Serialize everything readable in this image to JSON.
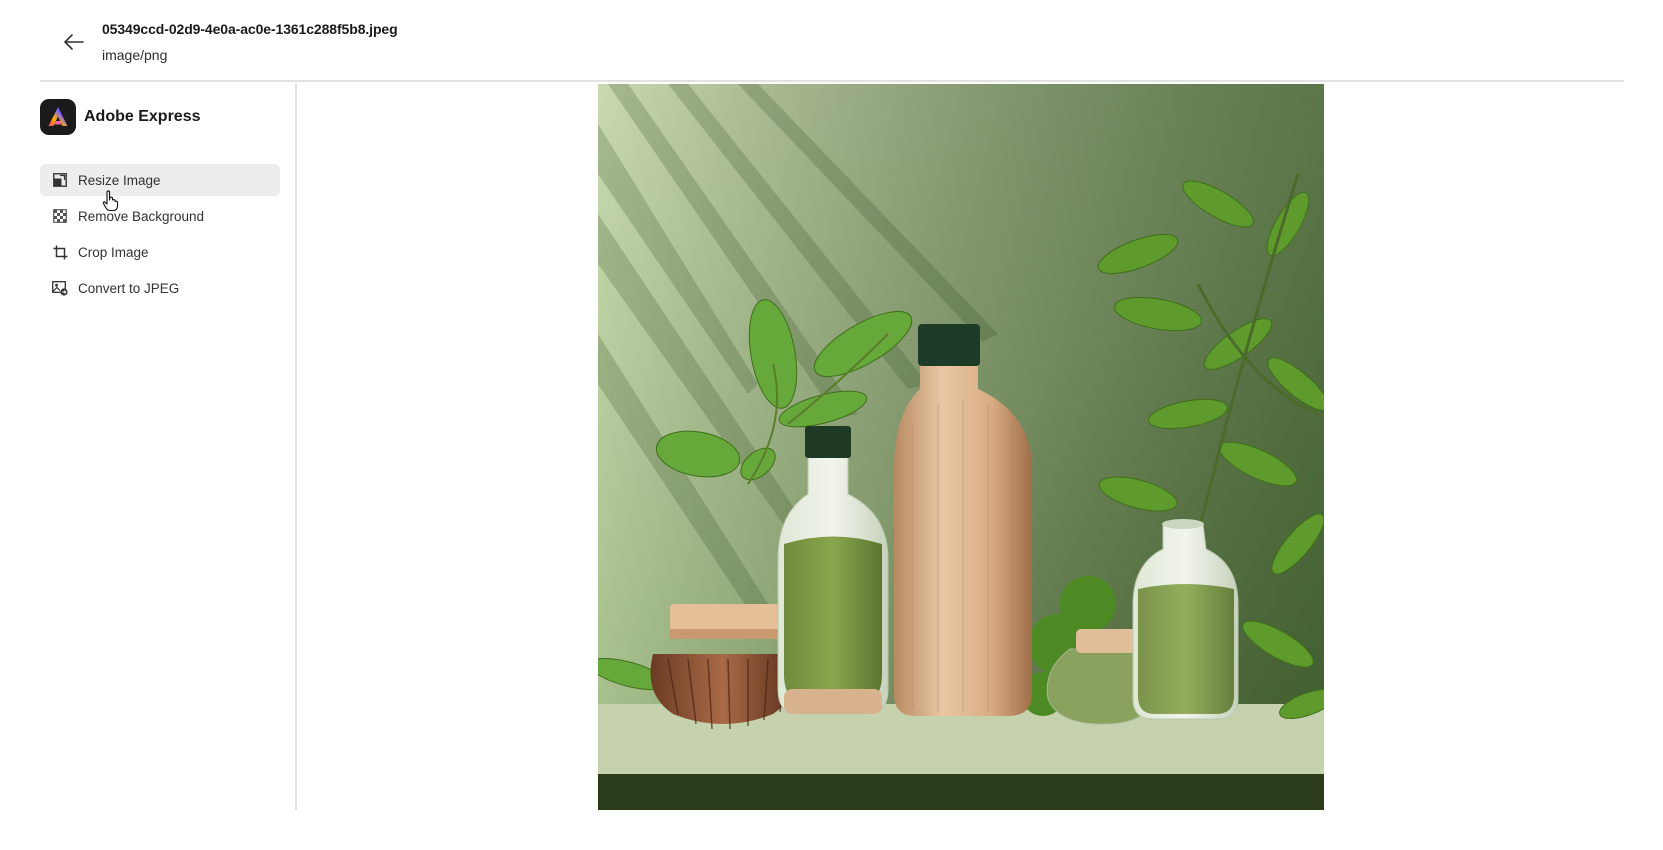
{
  "header": {
    "file_name": "05349ccd-02d9-4e0a-ac0e-1361c288f5b8.jpeg",
    "file_type": "image/png",
    "back_icon": "arrow-left-icon"
  },
  "sidebar": {
    "brand": {
      "name": "Adobe Express",
      "logo_icon": "adobe-express-logo"
    },
    "items": [
      {
        "label": "Resize Image",
        "icon": "resize-icon",
        "active": true
      },
      {
        "label": "Remove Background",
        "icon": "checkerboard-icon",
        "active": false
      },
      {
        "label": "Crop Image",
        "icon": "crop-icon",
        "active": false
      },
      {
        "label": "Convert to JPEG",
        "icon": "convert-image-icon",
        "active": false
      }
    ]
  },
  "preview": {
    "description_icon": "product-photo",
    "colors": {
      "wall": "#a9c08f",
      "shelf": "#c8d4b0",
      "shelf_front": "#2d3d1c",
      "leaf": "#6fa33b"
    }
  }
}
